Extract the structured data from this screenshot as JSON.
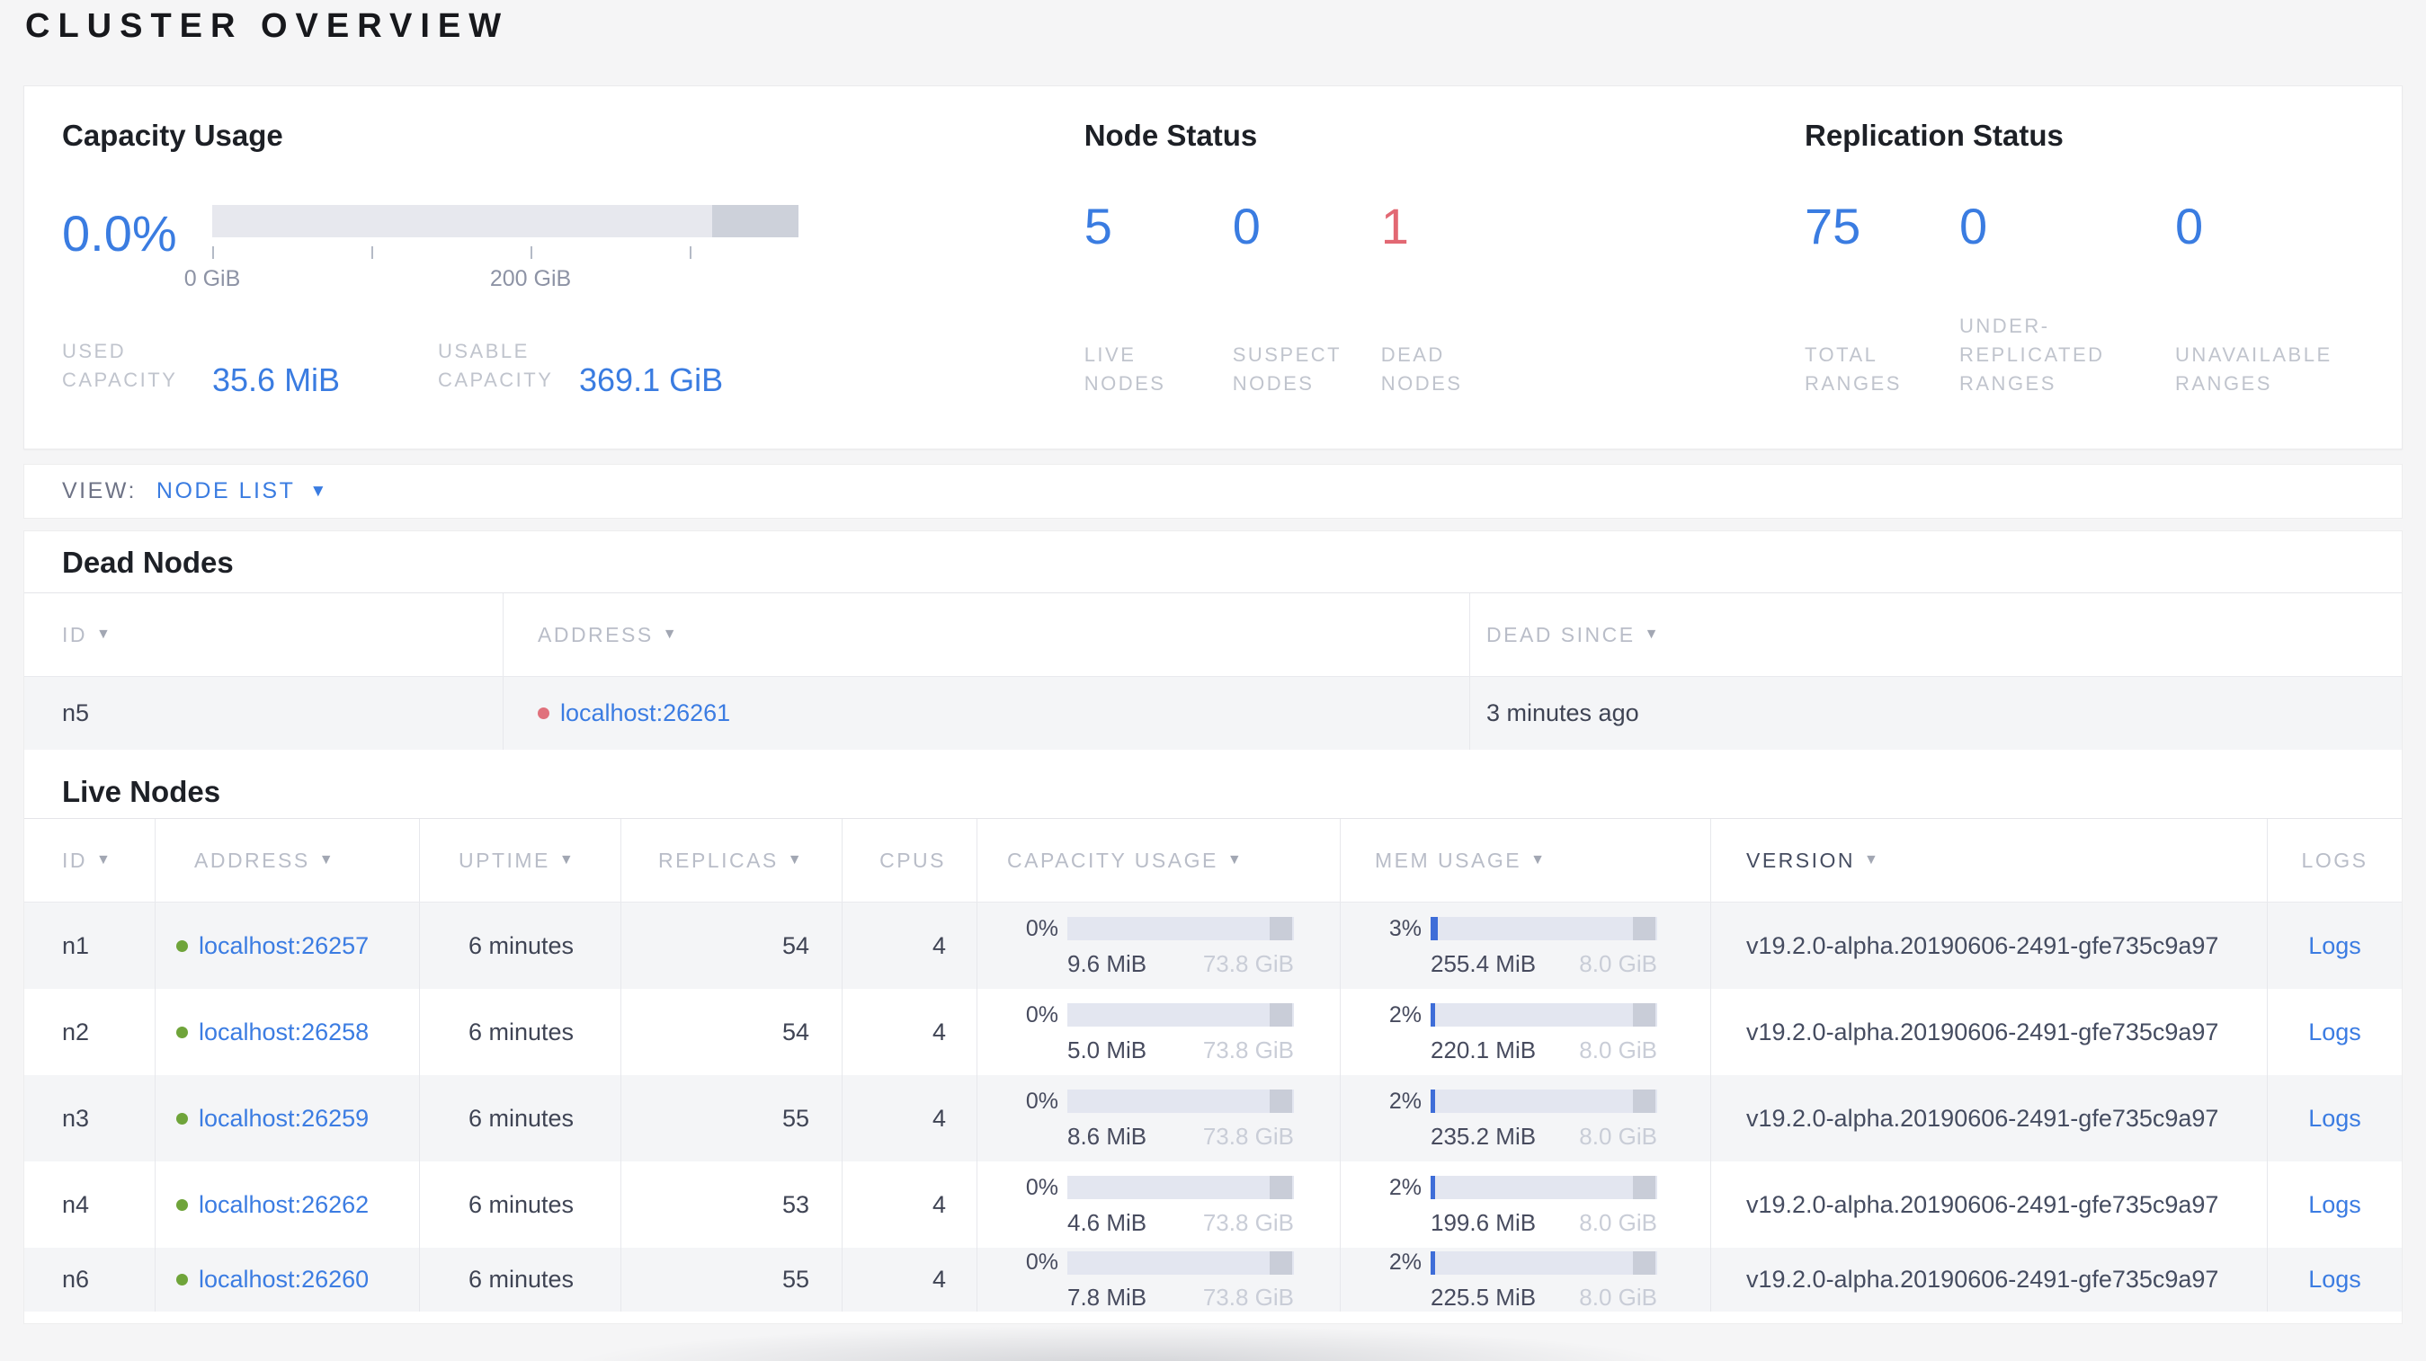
{
  "page": {
    "title": "CLUSTER OVERVIEW"
  },
  "colors": {
    "accent_blue": "#3a7ce1",
    "status_red": "#e26873",
    "dead_dot_red": "#e0717c",
    "live_dot_green": "#6fa43a",
    "bar_track": "#e3e6f0",
    "bar_dark_segment": "#c9cdd8",
    "bar_fill_blue": "#3e6dd8"
  },
  "overview": {
    "capacity": {
      "title": "Capacity Usage",
      "percent": "0.0%",
      "tick_labels": [
        "0 GiB",
        "200 GiB"
      ],
      "used_label": "USED CAPACITY",
      "used_value": "35.6 MiB",
      "usable_label": "USABLE CAPACITY",
      "usable_value": "369.1 GiB"
    },
    "node_status": {
      "title": "Node Status",
      "stats": [
        {
          "value": "5",
          "label": "LIVE NODES"
        },
        {
          "value": "0",
          "label": "SUSPECT NODES"
        },
        {
          "value": "1",
          "label": "DEAD NODES"
        }
      ]
    },
    "replication": {
      "title": "Replication Status",
      "stats": [
        {
          "value": "75",
          "label": "TOTAL RANGES"
        },
        {
          "value": "0",
          "label": "UNDER-REPLICATED RANGES"
        },
        {
          "value": "0",
          "label": "UNAVAILABLE RANGES"
        }
      ]
    }
  },
  "view_bar": {
    "label": "VIEW:",
    "selected": "NODE LIST"
  },
  "dead_nodes": {
    "title": "Dead Nodes",
    "columns": [
      {
        "label": "ID"
      },
      {
        "label": "ADDRESS"
      },
      {
        "label": "DEAD SINCE"
      }
    ],
    "rows": [
      {
        "id": "n5",
        "address": "localhost:26261",
        "dead_since": "3 minutes ago"
      }
    ]
  },
  "live_nodes": {
    "title": "Live Nodes",
    "columns": [
      {
        "label": "ID"
      },
      {
        "label": "ADDRESS"
      },
      {
        "label": "UPTIME"
      },
      {
        "label": "REPLICAS"
      },
      {
        "label": "CPUS"
      },
      {
        "label": "CAPACITY USAGE"
      },
      {
        "label": "MEM USAGE"
      },
      {
        "label": "VERSION"
      },
      {
        "label": "LOGS"
      }
    ],
    "rows": [
      {
        "id": "n1",
        "address": "localhost:26257",
        "uptime": "6 minutes",
        "replicas": "54",
        "cpus": "4",
        "cap_percent": "0%",
        "cap_used": "9.6 MiB",
        "cap_total": "73.8 GiB",
        "mem_percent": "3%",
        "mem_used": "255.4 MiB",
        "mem_total": "8.0 GiB",
        "version": "v19.2.0-alpha.20190606-2491-gfe735c9a97",
        "logs": "Logs"
      },
      {
        "id": "n2",
        "address": "localhost:26258",
        "uptime": "6 minutes",
        "replicas": "54",
        "cpus": "4",
        "cap_percent": "0%",
        "cap_used": "5.0 MiB",
        "cap_total": "73.8 GiB",
        "mem_percent": "2%",
        "mem_used": "220.1 MiB",
        "mem_total": "8.0 GiB",
        "version": "v19.2.0-alpha.20190606-2491-gfe735c9a97",
        "logs": "Logs"
      },
      {
        "id": "n3",
        "address": "localhost:26259",
        "uptime": "6 minutes",
        "replicas": "55",
        "cpus": "4",
        "cap_percent": "0%",
        "cap_used": "8.6 MiB",
        "cap_total": "73.8 GiB",
        "mem_percent": "2%",
        "mem_used": "235.2 MiB",
        "mem_total": "8.0 GiB",
        "version": "v19.2.0-alpha.20190606-2491-gfe735c9a97",
        "logs": "Logs"
      },
      {
        "id": "n4",
        "address": "localhost:26262",
        "uptime": "6 minutes",
        "replicas": "53",
        "cpus": "4",
        "cap_percent": "0%",
        "cap_used": "4.6 MiB",
        "cap_total": "73.8 GiB",
        "mem_percent": "2%",
        "mem_used": "199.6 MiB",
        "mem_total": "8.0 GiB",
        "version": "v19.2.0-alpha.20190606-2491-gfe735c9a97",
        "logs": "Logs"
      },
      {
        "id": "n6",
        "address": "localhost:26260",
        "uptime": "6 minutes",
        "replicas": "55",
        "cpus": "4",
        "cap_percent": "0%",
        "cap_used": "7.8 MiB",
        "cap_total": "73.8 GiB",
        "mem_percent": "2%",
        "mem_used": "225.5 MiB",
        "mem_total": "8.0 GiB",
        "version": "v19.2.0-alpha.20190606-2491-gfe735c9a97",
        "logs": "Logs"
      }
    ]
  }
}
